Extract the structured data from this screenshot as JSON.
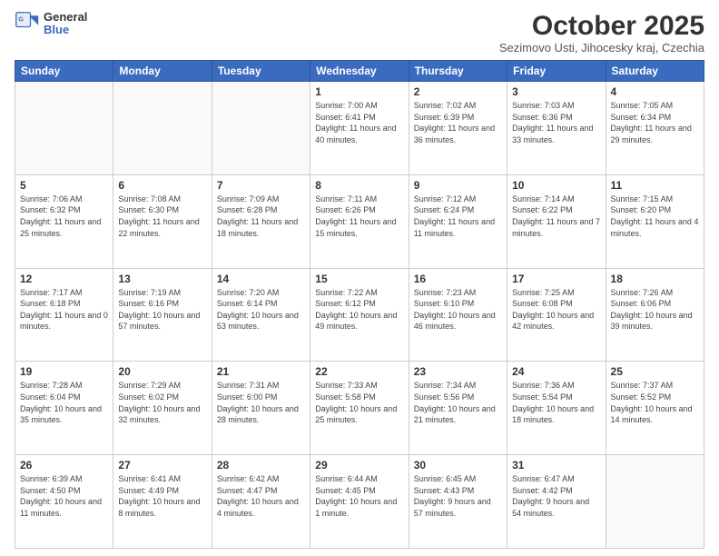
{
  "logo": {
    "general": "General",
    "blue": "Blue"
  },
  "header": {
    "month": "October 2025",
    "location": "Sezimovo Usti, Jihocesky kraj, Czechia"
  },
  "weekdays": [
    "Sunday",
    "Monday",
    "Tuesday",
    "Wednesday",
    "Thursday",
    "Friday",
    "Saturday"
  ],
  "weeks": [
    [
      {
        "day": "",
        "info": ""
      },
      {
        "day": "",
        "info": ""
      },
      {
        "day": "",
        "info": ""
      },
      {
        "day": "1",
        "info": "Sunrise: 7:00 AM\nSunset: 6:41 PM\nDaylight: 11 hours\nand 40 minutes."
      },
      {
        "day": "2",
        "info": "Sunrise: 7:02 AM\nSunset: 6:39 PM\nDaylight: 11 hours\nand 36 minutes."
      },
      {
        "day": "3",
        "info": "Sunrise: 7:03 AM\nSunset: 6:36 PM\nDaylight: 11 hours\nand 33 minutes."
      },
      {
        "day": "4",
        "info": "Sunrise: 7:05 AM\nSunset: 6:34 PM\nDaylight: 11 hours\nand 29 minutes."
      }
    ],
    [
      {
        "day": "5",
        "info": "Sunrise: 7:06 AM\nSunset: 6:32 PM\nDaylight: 11 hours\nand 25 minutes."
      },
      {
        "day": "6",
        "info": "Sunrise: 7:08 AM\nSunset: 6:30 PM\nDaylight: 11 hours\nand 22 minutes."
      },
      {
        "day": "7",
        "info": "Sunrise: 7:09 AM\nSunset: 6:28 PM\nDaylight: 11 hours\nand 18 minutes."
      },
      {
        "day": "8",
        "info": "Sunrise: 7:11 AM\nSunset: 6:26 PM\nDaylight: 11 hours\nand 15 minutes."
      },
      {
        "day": "9",
        "info": "Sunrise: 7:12 AM\nSunset: 6:24 PM\nDaylight: 11 hours\nand 11 minutes."
      },
      {
        "day": "10",
        "info": "Sunrise: 7:14 AM\nSunset: 6:22 PM\nDaylight: 11 hours\nand 7 minutes."
      },
      {
        "day": "11",
        "info": "Sunrise: 7:15 AM\nSunset: 6:20 PM\nDaylight: 11 hours\nand 4 minutes."
      }
    ],
    [
      {
        "day": "12",
        "info": "Sunrise: 7:17 AM\nSunset: 6:18 PM\nDaylight: 11 hours\nand 0 minutes."
      },
      {
        "day": "13",
        "info": "Sunrise: 7:19 AM\nSunset: 6:16 PM\nDaylight: 10 hours\nand 57 minutes."
      },
      {
        "day": "14",
        "info": "Sunrise: 7:20 AM\nSunset: 6:14 PM\nDaylight: 10 hours\nand 53 minutes."
      },
      {
        "day": "15",
        "info": "Sunrise: 7:22 AM\nSunset: 6:12 PM\nDaylight: 10 hours\nand 49 minutes."
      },
      {
        "day": "16",
        "info": "Sunrise: 7:23 AM\nSunset: 6:10 PM\nDaylight: 10 hours\nand 46 minutes."
      },
      {
        "day": "17",
        "info": "Sunrise: 7:25 AM\nSunset: 6:08 PM\nDaylight: 10 hours\nand 42 minutes."
      },
      {
        "day": "18",
        "info": "Sunrise: 7:26 AM\nSunset: 6:06 PM\nDaylight: 10 hours\nand 39 minutes."
      }
    ],
    [
      {
        "day": "19",
        "info": "Sunrise: 7:28 AM\nSunset: 6:04 PM\nDaylight: 10 hours\nand 35 minutes."
      },
      {
        "day": "20",
        "info": "Sunrise: 7:29 AM\nSunset: 6:02 PM\nDaylight: 10 hours\nand 32 minutes."
      },
      {
        "day": "21",
        "info": "Sunrise: 7:31 AM\nSunset: 6:00 PM\nDaylight: 10 hours\nand 28 minutes."
      },
      {
        "day": "22",
        "info": "Sunrise: 7:33 AM\nSunset: 5:58 PM\nDaylight: 10 hours\nand 25 minutes."
      },
      {
        "day": "23",
        "info": "Sunrise: 7:34 AM\nSunset: 5:56 PM\nDaylight: 10 hours\nand 21 minutes."
      },
      {
        "day": "24",
        "info": "Sunrise: 7:36 AM\nSunset: 5:54 PM\nDaylight: 10 hours\nand 18 minutes."
      },
      {
        "day": "25",
        "info": "Sunrise: 7:37 AM\nSunset: 5:52 PM\nDaylight: 10 hours\nand 14 minutes."
      }
    ],
    [
      {
        "day": "26",
        "info": "Sunrise: 6:39 AM\nSunset: 4:50 PM\nDaylight: 10 hours\nand 11 minutes."
      },
      {
        "day": "27",
        "info": "Sunrise: 6:41 AM\nSunset: 4:49 PM\nDaylight: 10 hours\nand 8 minutes."
      },
      {
        "day": "28",
        "info": "Sunrise: 6:42 AM\nSunset: 4:47 PM\nDaylight: 10 hours\nand 4 minutes."
      },
      {
        "day": "29",
        "info": "Sunrise: 6:44 AM\nSunset: 4:45 PM\nDaylight: 10 hours\nand 1 minute."
      },
      {
        "day": "30",
        "info": "Sunrise: 6:45 AM\nSunset: 4:43 PM\nDaylight: 9 hours\nand 57 minutes."
      },
      {
        "day": "31",
        "info": "Sunrise: 6:47 AM\nSunset: 4:42 PM\nDaylight: 9 hours\nand 54 minutes."
      },
      {
        "day": "",
        "info": ""
      }
    ]
  ]
}
